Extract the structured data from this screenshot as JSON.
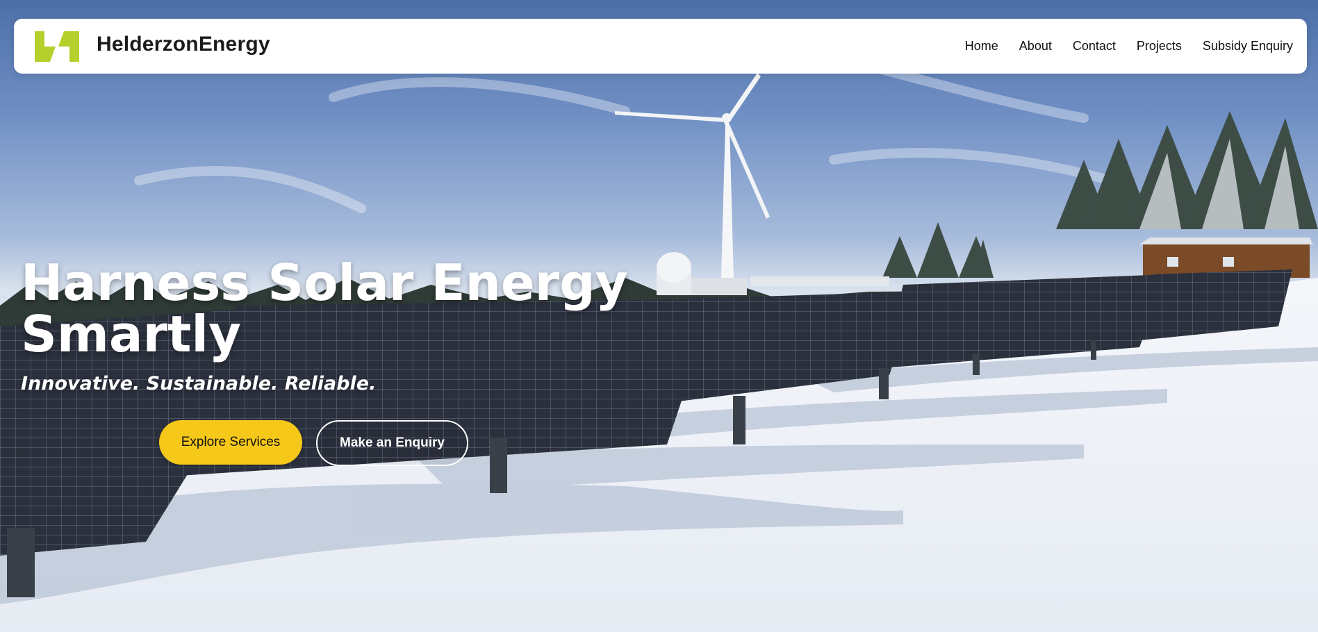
{
  "brand": {
    "name": "HelderzonEnergy",
    "logo_icon": "helderzon-logo-icon",
    "logo_color": "#b5cf2c"
  },
  "nav": {
    "items": [
      {
        "label": "Home"
      },
      {
        "label": "About"
      },
      {
        "label": "Contact"
      },
      {
        "label": "Projects"
      },
      {
        "label": "Subsidy Enquiry"
      }
    ]
  },
  "hero": {
    "headline": "Harness Solar Energy Smartly",
    "tagline": "Innovative. Sustainable. Reliable.",
    "primary_button": "Explore Services",
    "secondary_button": "Make an Enquiry",
    "background_image": "solar-farm-snow-wind-turbine-image"
  },
  "colors": {
    "accent_yellow": "#f6c81a",
    "logo_green": "#b5cf2c",
    "white": "#ffffff"
  }
}
